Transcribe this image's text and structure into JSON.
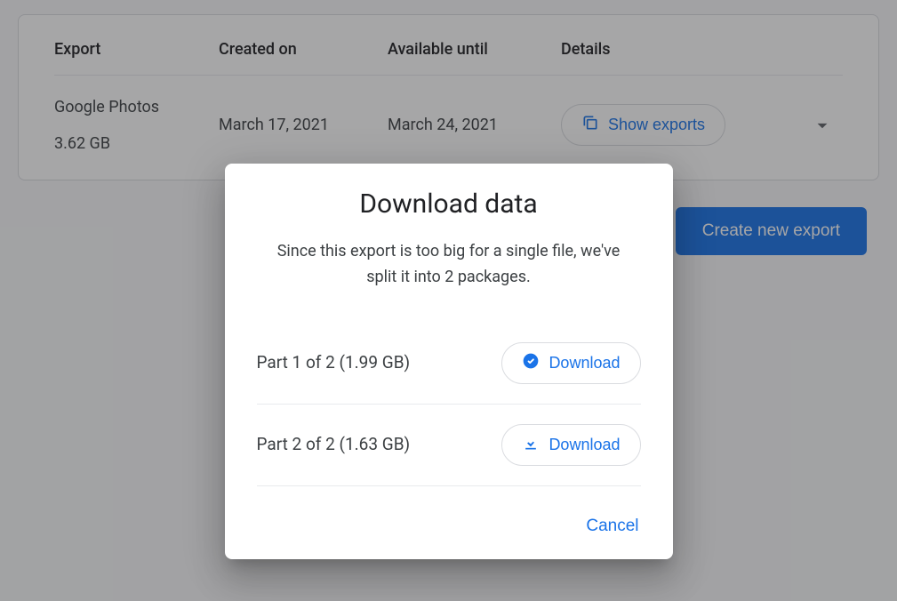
{
  "table": {
    "headers": {
      "export": "Export",
      "created": "Created on",
      "available": "Available until",
      "details": "Details"
    },
    "row": {
      "name": "Google Photos",
      "size": "3.62 GB",
      "created": "March 17, 2021",
      "available": "March 24, 2021",
      "show_exports_label": "Show exports"
    }
  },
  "create_export_label": "Create new export",
  "modal": {
    "title": "Download data",
    "subtitle": "Since this export is too big for a single file, we've split it into 2 packages.",
    "parts": [
      {
        "label": "Part 1 of 2 (1.99 GB)",
        "download_label": "Download",
        "downloaded": true
      },
      {
        "label": "Part 2 of 2 (1.63 GB)",
        "download_label": "Download",
        "downloaded": false
      }
    ],
    "cancel_label": "Cancel"
  }
}
